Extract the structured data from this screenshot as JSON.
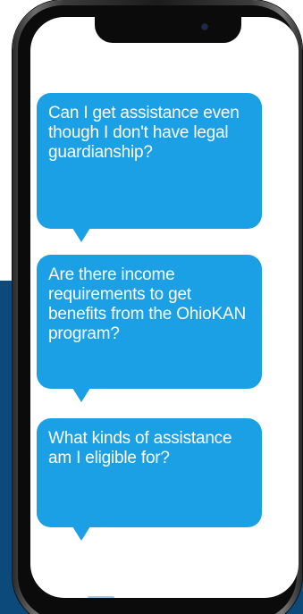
{
  "messages": [
    {
      "text": "Can I get assistance even though I don't have legal guardianship?"
    },
    {
      "text": "Are there income requirements to get benefits from the OhioKAN program?"
    },
    {
      "text": "What kinds of assistance am I eligible for?"
    }
  ],
  "colors": {
    "bubble": "#1b9fe5",
    "bubble_text": "#ffffff",
    "background_band": "#0d4a7c",
    "phone_frame": "#1c1c1c",
    "screen": "#ffffff"
  }
}
